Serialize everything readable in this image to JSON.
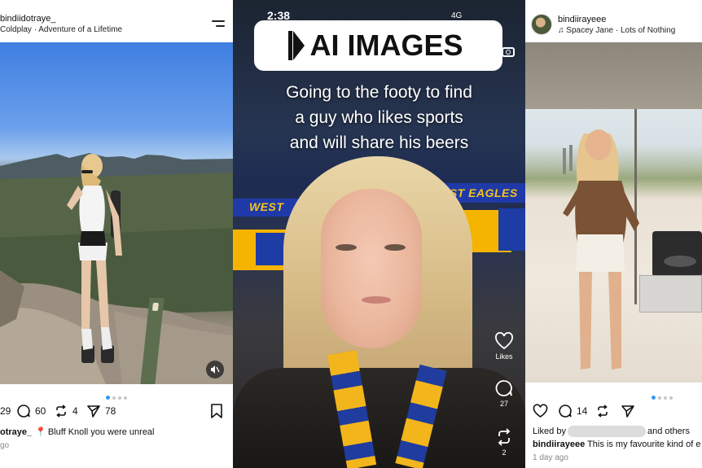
{
  "left_post": {
    "username": "bindiidotraye_",
    "song": "Coldplay · Adventure of a Lifetime",
    "actions": {
      "likes": "29",
      "comments": "60",
      "reposts": "4",
      "shares": "78"
    },
    "caption_user": "otraye_",
    "caption_text": "Bluff Knoll you were unreal",
    "date": "go",
    "carousel_index": 1,
    "carousel_total": 4
  },
  "middle_video": {
    "status_time": "2:38",
    "status_network": "4G",
    "badge_text": "AI IMAGES",
    "overlay_lines": [
      "Going to the footy to find",
      "a guy who likes sports",
      "and will share his beers"
    ],
    "sign_left": "WEST",
    "sign_right": "EST EAGLES",
    "side_actions": {
      "likes_label": "Likes",
      "comments_count": "27",
      "shares_count": "2"
    }
  },
  "right_post": {
    "username": "bindiirayeee",
    "song": "Spacey Jane · Lots of Nothing",
    "actions": {
      "comments": "14"
    },
    "liked_by_prefix": "Liked by",
    "liked_by_suffix": "and others",
    "caption_user": "bindiirayeee",
    "caption_text": "This is my favourite kind of e",
    "date": "1 day ago",
    "carousel_index": 1,
    "carousel_total": 4
  },
  "colors": {
    "instagram_blue": "#3897f0",
    "eagles_blue": "#1f3aa8",
    "eagles_yellow": "#f4b400",
    "pin_red": "#e0245e"
  }
}
